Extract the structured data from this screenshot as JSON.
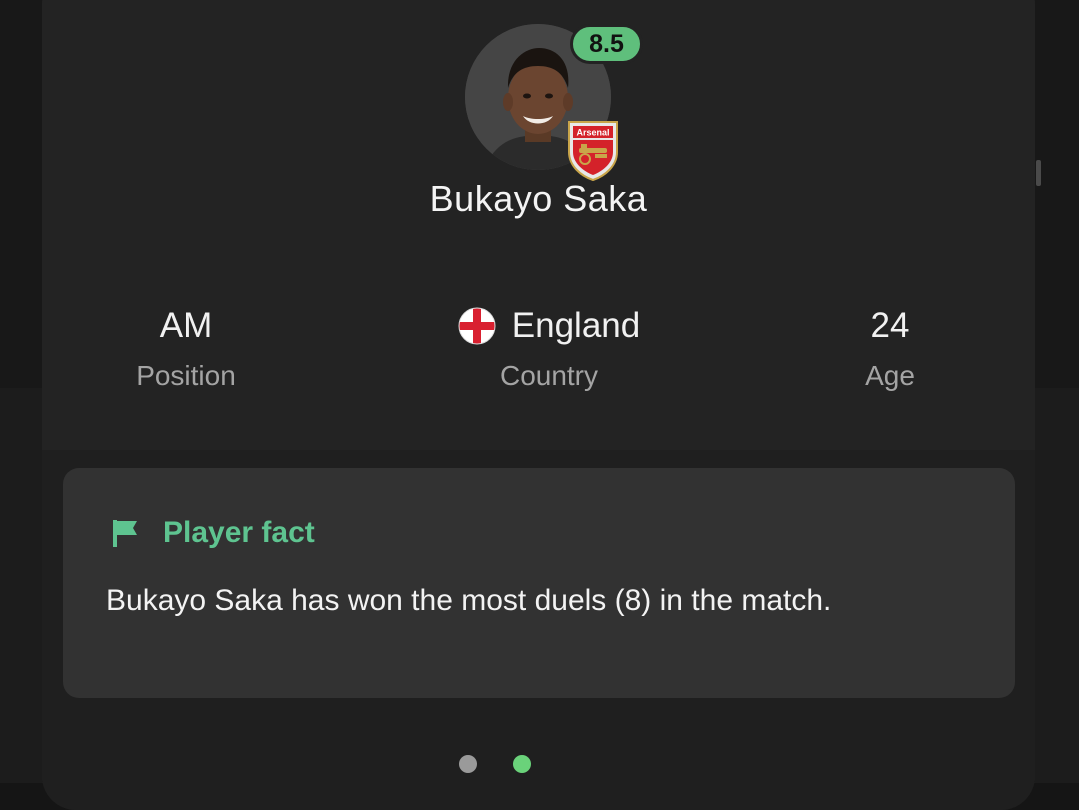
{
  "player": {
    "name": "Bukayo Saka",
    "rating": "8.5",
    "club_badge_text": "Arsenal"
  },
  "stats": {
    "position": {
      "value": "AM",
      "label": "Position"
    },
    "country": {
      "value": "England",
      "label": "Country",
      "flag_icon": "england-flag-icon"
    },
    "age": {
      "value": "24",
      "label": "Age"
    }
  },
  "fact": {
    "title": "Player fact",
    "text": "Bukayo Saka has won the most duels (8) in the match.",
    "icon": "flag-icon"
  },
  "pager": {
    "total": 2,
    "active_index": 1
  },
  "colors": {
    "rating_badge": "#5fbf7c",
    "fact_title": "#5ec490",
    "active_dot": "#6ad27a",
    "inactive_dot": "#9a9a9a"
  }
}
